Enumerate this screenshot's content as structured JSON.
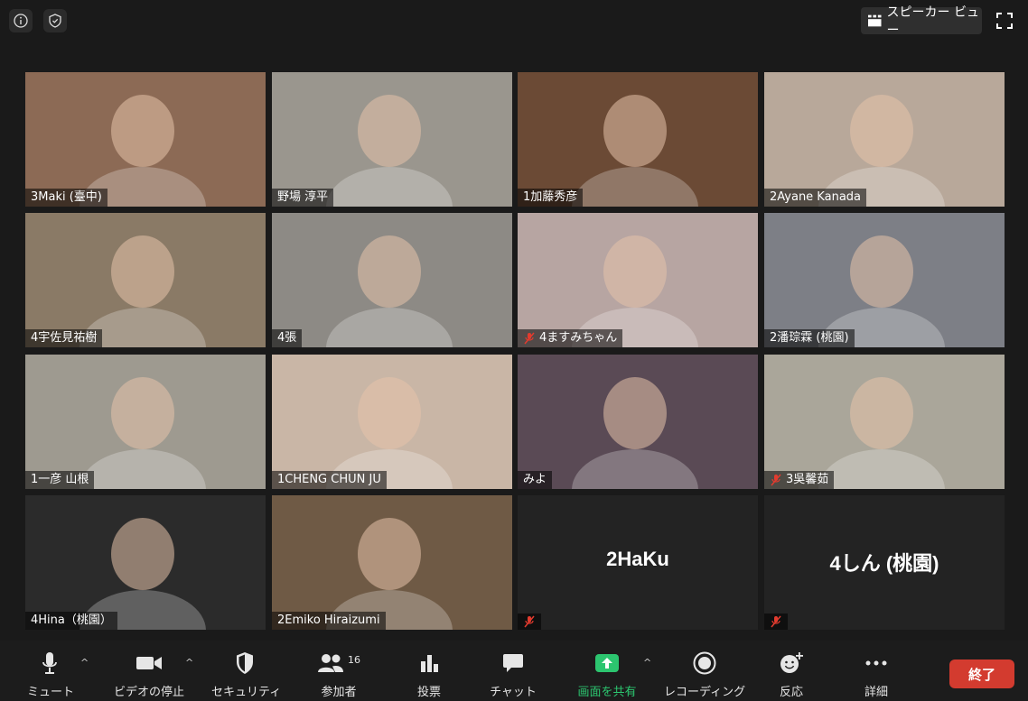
{
  "top": {
    "speaker_view_label": "スピーカー ビュー"
  },
  "participants": [
    {
      "name": "3Maki (臺中)",
      "muted": false,
      "bg": "#8c6a55",
      "active": false
    },
    {
      "name": "野場 淳平",
      "muted": false,
      "bg": "#9a968e",
      "active": false
    },
    {
      "name": "1加藤秀彦",
      "muted": false,
      "bg": "#6b4a35",
      "active": false
    },
    {
      "name": "2Ayane Kanada",
      "muted": false,
      "bg": "#b8a89a",
      "active": false
    },
    {
      "name": "4宇佐見祐樹",
      "muted": false,
      "bg": "#8a7a66",
      "active": true
    },
    {
      "name": "4張",
      "muted": false,
      "bg": "#8d8a85",
      "active": false
    },
    {
      "name": "4ますみちゃん",
      "muted": true,
      "bg": "#b7a5a2",
      "active": false
    },
    {
      "name": "2潘琮霖 (桃園)",
      "muted": false,
      "bg": "#7d7f86",
      "active": false
    },
    {
      "name": "1一彦 山根",
      "muted": false,
      "bg": "#9e9a90",
      "active": false
    },
    {
      "name": "1CHENG CHUN JU",
      "muted": false,
      "bg": "#c9b6a6",
      "active": false
    },
    {
      "name": "みよ",
      "muted": false,
      "bg": "#5a4a55",
      "active": false
    },
    {
      "name": "3吳馨茹",
      "muted": true,
      "bg": "#aaa69a",
      "active": false
    },
    {
      "name": "4Hina（桃園）",
      "muted": false,
      "bg": "#2b2b2b",
      "active": false
    },
    {
      "name": "2Emiko Hiraizumi",
      "muted": false,
      "bg": "#6f5a45",
      "active": false
    },
    {
      "name": "2HaKu",
      "muted": true,
      "bg": "#232323",
      "video_off": true,
      "active": false
    },
    {
      "name": "4しん (桃園)",
      "muted": true,
      "bg": "#232323",
      "video_off": true,
      "active": false
    }
  ],
  "toolbar": {
    "mute": "ミュート",
    "video": "ビデオの停止",
    "security": "セキュリティ",
    "participants": "参加者",
    "participants_count": "16",
    "poll": "投票",
    "chat": "チャット",
    "share": "画面を共有",
    "record": "レコーディング",
    "reactions": "反応",
    "more": "詳細",
    "end": "終了"
  },
  "colors": {
    "share_accent": "#2cc56f",
    "end_button": "#d33b2f",
    "active_speaker": "#d9e85d"
  }
}
